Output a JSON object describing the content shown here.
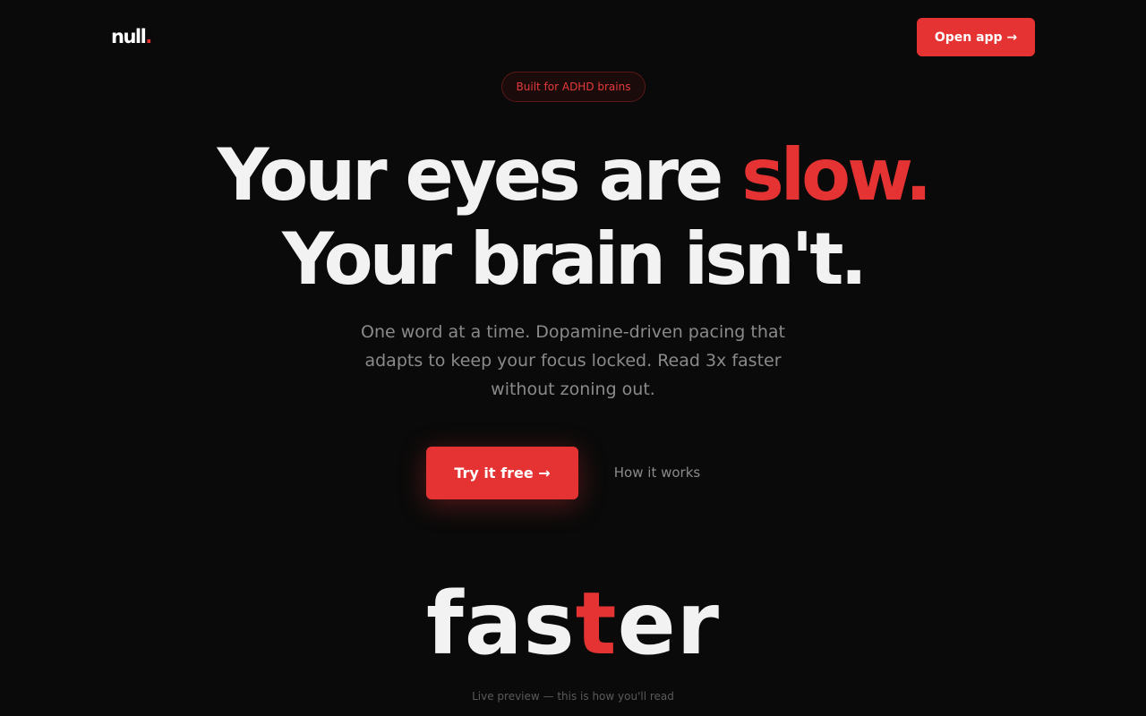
{
  "header": {
    "logo_text": "null",
    "logo_dot": ".",
    "open_app_label": "Open app →"
  },
  "hero": {
    "badge": "Built for ADHD brains",
    "headline_line1_a": "Your eyes are ",
    "headline_line1_accent": "slow.",
    "headline_line2": "Your brain isn't.",
    "subtext": "One word at a time. Dopamine-driven pacing that adapts to keep your focus locked. Read 3x faster without zoning out.",
    "cta_primary": "Try it free →",
    "cta_secondary": "How it works"
  },
  "preview": {
    "word_before": "fas",
    "word_focus": "t",
    "word_after": "er",
    "caption": "Live preview — this is how you'll read"
  },
  "colors": {
    "background": "#0a0a0a",
    "accent": "#e53333",
    "text": "#f2f2f2",
    "muted": "#8a8a8a"
  }
}
